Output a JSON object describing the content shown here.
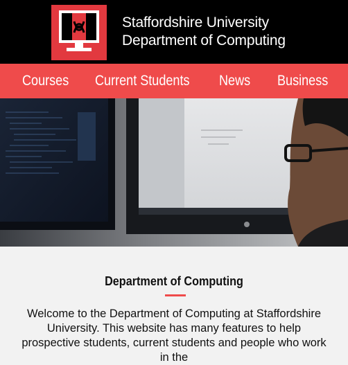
{
  "header": {
    "brand_line1": "Staffordshire University",
    "brand_line2": "Department of Computing",
    "logo_icon": "computer-monitor-knot-icon"
  },
  "nav": {
    "items": [
      {
        "label": "Courses"
      },
      {
        "label": "Current Students"
      },
      {
        "label": "News"
      },
      {
        "label": "Business"
      }
    ]
  },
  "hero": {
    "image": "person-working-at-computer-monitors-photo"
  },
  "main": {
    "title": "Department of Computing",
    "intro": "Welcome to the Department of Computing at Staffordshire University. This website has many features to help prospective students, current students and people who work in the"
  },
  "colors": {
    "header_bg": "#000000",
    "nav_bg": "#ef4b4b",
    "accent": "#e2393f",
    "page_bg": "#f2f2f2"
  }
}
